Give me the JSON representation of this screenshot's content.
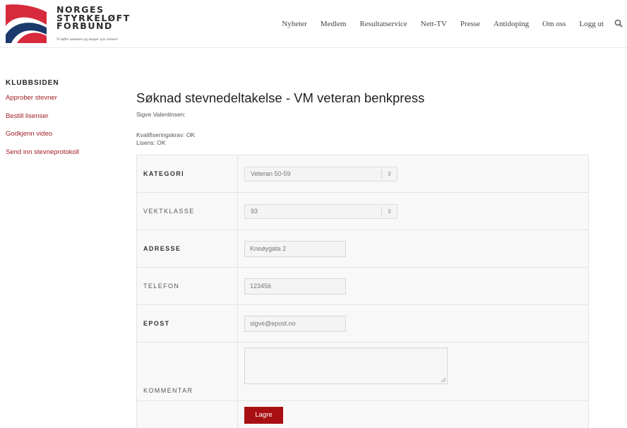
{
  "brand": {
    "name_line1": "NORGES",
    "name_line2": "STYRKELØFT",
    "name_line3": "FORBUND",
    "tagline": "Vi løfter sammen og skaper nye vinnere",
    "colors": {
      "red": "#d72a3c",
      "navy": "#1b3a6b",
      "accent": "#a01d24"
    }
  },
  "nav": {
    "items": [
      "Nyheter",
      "Medlem",
      "Resultatservice",
      "Nett-TV",
      "Presse",
      "Antidoping",
      "Om oss",
      "Logg ut"
    ],
    "search_icon": "search-icon"
  },
  "sidebar": {
    "title": "KLUBBSIDEN",
    "links": [
      "Approber stevner",
      "Bestill lisenser",
      "Godkjenn video",
      "Send inn stevneprotokoll"
    ]
  },
  "main": {
    "title": "Søknad stevnedeltakelse - VM veteran benkpress",
    "athlete": "Sigve Valentinsen:",
    "qualification": "Kvalifiseringskrav: OK",
    "license": "Lisens: OK"
  },
  "form": {
    "kategori": {
      "label": "KATEGORI",
      "value": "Veteran 50-59"
    },
    "vektklasse": {
      "label": "VEKTKLASSE",
      "value": "93"
    },
    "adresse": {
      "label": "ADRESSE",
      "value": "Kneøygata 2"
    },
    "telefon": {
      "label": "TELEFON",
      "value": "123456"
    },
    "epost": {
      "label": "EPOST",
      "value": "sigve@epost.no"
    },
    "kommentar": {
      "label": "KOMMENTAR",
      "value": ""
    },
    "save_label": "Lagre"
  }
}
